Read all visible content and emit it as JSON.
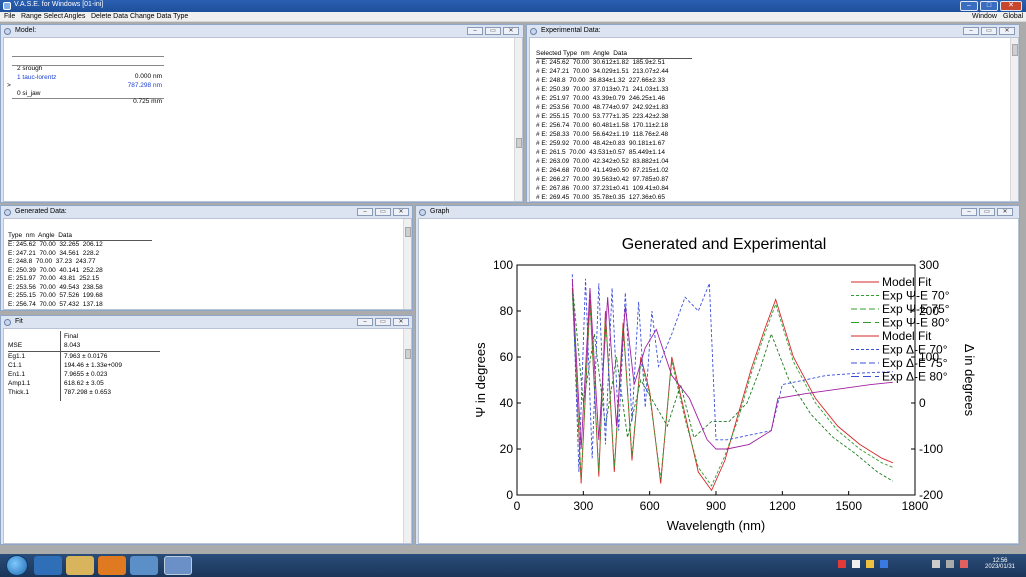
{
  "window": {
    "title": "V.A.S.E. for Windows [01-ini]",
    "controls": [
      "–",
      "□",
      "✕"
    ]
  },
  "menu": {
    "left": [
      "File",
      "Range Select",
      "Angles",
      "Delete Data",
      "Change Data Type"
    ],
    "right": [
      "Window",
      "Global"
    ]
  },
  "model": {
    "title": "Model:",
    "layers": [
      {
        "marker": "",
        "name": "2 srough",
        "value": "0.000 nm"
      },
      {
        "marker": "",
        "name": "1 tauc-lorentz",
        "value": "787.298 nm"
      },
      {
        "marker": ">",
        "name": "0 si_jaw",
        "value": "0.725 mm"
      }
    ]
  },
  "experimental": {
    "title": "Experimental Data:",
    "header": "Selected Type  nm  Angle  Data",
    "rows": [
      "# E: 245.62  70.00  30.612±1.82  185.9±2.51",
      "# E: 247.21  70.00  34.029±1.51  213.07±2.44",
      "# E: 248.8  70.00  36.834±1.32  227.66±2.33",
      "# E: 250.39  70.00  37.013±0.71  241.03±1.33",
      "# E: 251.97  70.00  43.39±0.79  246.25±1.46",
      "# E: 253.56  70.00  48.774±0.97  242.92±1.83",
      "# E: 255.15  70.00  53.777±1.35  223.42±2.38",
      "# E: 256.74  70.00  60.481±1.58  170.11±2.18",
      "# E: 258.33  70.00  56.642±1.19  118.76±2.48",
      "# E: 259.92  70.00  48.42±0.83  90.181±1.67",
      "# E: 261.5  70.00  43.531±0.57  85.449±1.14",
      "# E: 263.09  70.00  42.342±0.52  83.882±1.04",
      "# E: 264.68  70.00  41.149±0.50  87.215±1.02",
      "# E: 266.27  70.00  39.563±0.42  97.785±0.87",
      "# E: 267.86  70.00  37.231±0.41  109.41±0.84",
      "# E: 269.45  70.00  35.78±0.35  127.36±0.65"
    ]
  },
  "generated": {
    "title": "Generated Data:",
    "header": "Type  nm  Angle  Data",
    "rows": [
      "E: 245.62  70.00  32.265  206.12",
      "E: 247.21  70.00  34.561  228.2",
      "E: 248.8  70.00  37.23  243.77",
      "E: 250.39  70.00  40.141  252.28",
      "E: 251.97  70.00  43.81  252.15",
      "E: 253.56  70.00  49.543  238.58",
      "E: 255.15  70.00  57.526  199.68",
      "E: 256.74  70.00  57.432  137.18"
    ]
  },
  "fit": {
    "title": "Fit",
    "col_header": "Final",
    "mse_label": "MSE",
    "mse_value": "8.043",
    "params": [
      {
        "name": "Eg1.1",
        "value": "7.963 ± 0.0176"
      },
      {
        "name": "C1.1",
        "value": "194.46 ± 1.33e+009"
      },
      {
        "name": "En1.1",
        "value": "7.9655 ± 0.023"
      },
      {
        "name": "Amp1.1",
        "value": "618.62 ± 3.05"
      },
      {
        "name": "Thick.1",
        "value": "787.298 ± 0.653"
      }
    ]
  },
  "graph": {
    "title": "Graph"
  },
  "chart_data": {
    "type": "line",
    "title": "Generated and Experimental",
    "xlabel": "Wavelength (nm)",
    "ylabel": "Ψ in degrees",
    "y2label": "Δ in degrees",
    "xlim": [
      0,
      1800
    ],
    "ylim": [
      0,
      100
    ],
    "y2lim": [
      -200,
      300
    ],
    "xticks": [
      0,
      300,
      600,
      900,
      1200,
      1500,
      1800
    ],
    "yticks": [
      0,
      20,
      40,
      60,
      80,
      100
    ],
    "y2ticks": [
      -200,
      -100,
      0,
      100,
      200,
      300
    ],
    "legend_position": "right",
    "legend": [
      {
        "label": "Model Fit",
        "color": "#d62728",
        "dash": ""
      },
      {
        "label": "Exp Ψ-E 70°",
        "color": "#2ca02c",
        "dash": "3,2"
      },
      {
        "label": "Exp Ψ-E 75°",
        "color": "#2ca02c",
        "dash": "6,3"
      },
      {
        "label": "Exp Ψ-E 80°",
        "color": "#2ca02c",
        "dash": "8,4"
      },
      {
        "label": "Model Fit",
        "color": "#d62728",
        "dash": ""
      },
      {
        "label": "Exp Δ-E 70°",
        "color": "#3b4fd8",
        "dash": "3,2"
      },
      {
        "label": "Exp Δ-E 75°",
        "color": "#3b4fd8",
        "dash": "6,3"
      },
      {
        "label": "Exp Δ-E 80°",
        "color": "#3b4fd8",
        "dash": "8,4"
      }
    ],
    "psi_series": [
      {
        "name": "Model Fit",
        "axis": "left",
        "color": "#d62728",
        "x": [
          250,
          290,
          330,
          370,
          400,
          440,
          480,
          520,
          560,
          600,
          650,
          700,
          760,
          820,
          880,
          940,
          1000,
          1060,
          1120,
          1170,
          1250,
          1350,
          1450,
          1550,
          1650,
          1700
        ],
        "y": [
          90,
          5,
          85,
          8,
          80,
          10,
          75,
          15,
          60,
          45,
          5,
          60,
          35,
          10,
          2,
          15,
          35,
          55,
          72,
          85,
          60,
          42,
          30,
          22,
          16,
          14
        ]
      },
      {
        "name": "Exp Ψ-E 70°",
        "axis": "left",
        "color": "#2ca02c",
        "x": [
          250,
          290,
          330,
          370,
          400,
          440,
          480,
          520,
          560,
          600,
          650,
          700,
          760,
          820,
          880,
          940,
          1000,
          1060,
          1120,
          1170,
          1250,
          1350,
          1450,
          1550,
          1650,
          1700
        ],
        "y": [
          88,
          7,
          83,
          10,
          78,
          12,
          73,
          17,
          58,
          43,
          7,
          58,
          33,
          12,
          4,
          17,
          33,
          53,
          70,
          83,
          58,
          40,
          28,
          20,
          14,
          12
        ]
      },
      {
        "name": "Exp Ψ-E 80°",
        "axis": "left",
        "color": "#1f7a1f",
        "x": [
          250,
          300,
          350,
          400,
          450,
          500,
          560,
          620,
          680,
          740,
          800,
          880,
          960,
          1040,
          1100,
          1150,
          1230,
          1330,
          1430,
          1530,
          1630,
          1700
        ],
        "y": [
          92,
          40,
          70,
          30,
          60,
          25,
          50,
          40,
          30,
          48,
          25,
          32,
          32,
          40,
          55,
          70,
          50,
          35,
          25,
          18,
          10,
          6
        ]
      }
    ],
    "delta_series": [
      {
        "name": "Exp Δ-E 70°",
        "axis": "right",
        "color": "#3b4fd8",
        "x": [
          250,
          280,
          310,
          340,
          370,
          400,
          430,
          460,
          490,
          520,
          550,
          580,
          610,
          640,
          700,
          760,
          820,
          870,
          900,
          950,
          1050,
          1150,
          1200,
          1300,
          1400,
          1550,
          1700
        ],
        "y": [
          280,
          -150,
          270,
          -120,
          260,
          -90,
          250,
          -60,
          240,
          -40,
          220,
          -10,
          200,
          80,
          150,
          230,
          200,
          260,
          -80,
          -80,
          -70,
          -60,
          40,
          50,
          60,
          65,
          68
        ]
      },
      {
        "name": "Exp Δ-E 80°",
        "axis": "right",
        "color": "#a020a0",
        "x": [
          250,
          290,
          330,
          370,
          410,
          450,
          490,
          530,
          580,
          630,
          700,
          780,
          860,
          900,
          950,
          1050,
          1150,
          1180,
          1300,
          1450,
          1600,
          1700
        ],
        "y": [
          270,
          -100,
          250,
          -80,
          230,
          -50,
          210,
          40,
          120,
          160,
          60,
          10,
          -80,
          -100,
          -100,
          -90,
          -60,
          10,
          20,
          30,
          40,
          45
        ]
      }
    ]
  }
}
